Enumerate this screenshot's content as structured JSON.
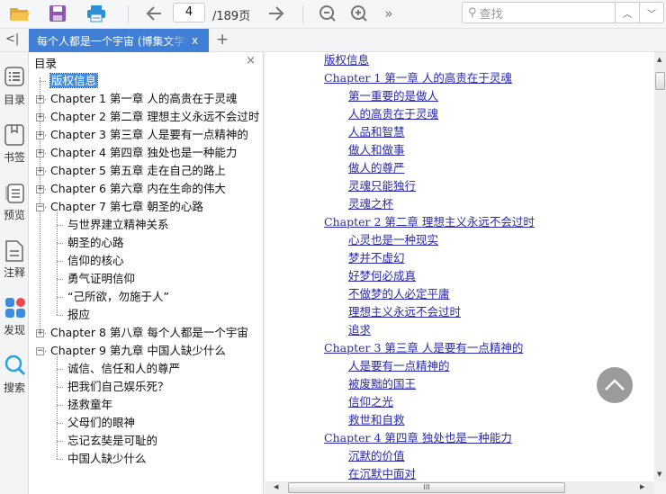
{
  "toolbar": {
    "page_current": "4",
    "page_total": "/189页",
    "search_placeholder": "查找",
    "more": "»"
  },
  "tab": {
    "title": "每个人都是一个宇宙 (博集文学典藏)",
    "close": "x",
    "add": "+",
    "collapse": "<|"
  },
  "leftbar": {
    "items": [
      {
        "label": "目录",
        "icon": "list-icon"
      },
      {
        "label": "书签",
        "icon": "bookmark-icon"
      },
      {
        "label": "预览",
        "icon": "preview-icon"
      },
      {
        "label": "注释",
        "icon": "note-icon"
      },
      {
        "label": "发现",
        "icon": "discover-icon"
      },
      {
        "label": "搜索",
        "icon": "search-icon"
      }
    ]
  },
  "toc": {
    "title": "目录",
    "close": "×",
    "items": [
      {
        "label": "版权信息",
        "level": 0,
        "selected": true
      },
      {
        "label": "Chapter 1 第一章 人的高贵在于灵魂",
        "level": 0,
        "toggle": "+"
      },
      {
        "label": "Chapter 2 第二章 理想主义永远不会过时",
        "level": 0,
        "toggle": "+"
      },
      {
        "label": "Chapter 3 第三章 人是要有一点精神的",
        "level": 0,
        "toggle": "+"
      },
      {
        "label": "Chapter 4 第四章 独处也是一种能力",
        "level": 0,
        "toggle": "+"
      },
      {
        "label": "Chapter 5 第五章 走在自己的路上",
        "level": 0,
        "toggle": "+"
      },
      {
        "label": "Chapter 6 第六章 内在生命的伟大",
        "level": 0,
        "toggle": "+"
      },
      {
        "label": "Chapter 7 第七章 朝圣的心路",
        "level": 0,
        "toggle": "−"
      },
      {
        "label": "与世界建立精神关系",
        "level": 1
      },
      {
        "label": "朝圣的心路",
        "level": 1
      },
      {
        "label": "信仰的核心",
        "level": 1
      },
      {
        "label": "勇气证明信仰",
        "level": 1
      },
      {
        "label": "“己所欲，勿施于人”",
        "level": 1
      },
      {
        "label": "报应",
        "level": 1
      },
      {
        "label": "Chapter 8 第八章 每个人都是一个宇宙",
        "level": 0,
        "toggle": "+"
      },
      {
        "label": "Chapter 9 第九章 中国人缺少什么",
        "level": 0,
        "toggle": "−"
      },
      {
        "label": "诚信、信任和人的尊严",
        "level": 1
      },
      {
        "label": "把我们自己娱乐死？",
        "level": 1
      },
      {
        "label": "拯救童年",
        "level": 1
      },
      {
        "label": "父母们的眼神",
        "level": 1
      },
      {
        "label": "忘记玄奘是可耻的",
        "level": 1
      },
      {
        "label": "中国人缺少什么",
        "level": 1
      }
    ]
  },
  "content": {
    "links": [
      {
        "label": "版权信息",
        "level": 0
      },
      {
        "label": "Chapter 1 第一章 人的高贵在于灵魂",
        "level": 0
      },
      {
        "label": "第一重要的是做人",
        "level": 1
      },
      {
        "label": "人的高贵在于灵魂",
        "level": 1
      },
      {
        "label": "人品和智慧",
        "level": 1
      },
      {
        "label": "做人和做事",
        "level": 1
      },
      {
        "label": "做人的尊严",
        "level": 1
      },
      {
        "label": "灵魂只能独行",
        "level": 1
      },
      {
        "label": "灵魂之杯",
        "level": 1
      },
      {
        "label": "Chapter 2 第二章 理想主义永远不会过时",
        "level": 0
      },
      {
        "label": "心灵也是一种现实",
        "level": 1
      },
      {
        "label": "梦并不虚幻",
        "level": 1
      },
      {
        "label": "好梦何必成真",
        "level": 1
      },
      {
        "label": "不做梦的人必定平庸",
        "level": 1
      },
      {
        "label": "理想主义永远不会过时",
        "level": 1
      },
      {
        "label": "追求",
        "level": 1
      },
      {
        "label": "Chapter 3 第三章 人是要有一点精神的",
        "level": 0
      },
      {
        "label": "人是要有一点精神的",
        "level": 1
      },
      {
        "label": "被废黜的国王",
        "level": 1
      },
      {
        "label": "信仰之光",
        "level": 1
      },
      {
        "label": "救世和自救",
        "level": 1
      },
      {
        "label": "Chapter 4 第四章 独处也是一种能力",
        "level": 0
      },
      {
        "label": "沉默的价值",
        "level": 1
      },
      {
        "label": "在沉默中面对",
        "level": 1
      }
    ]
  },
  "colors": {
    "accent": "#3f7fd6",
    "link": "#2a2ab0"
  }
}
